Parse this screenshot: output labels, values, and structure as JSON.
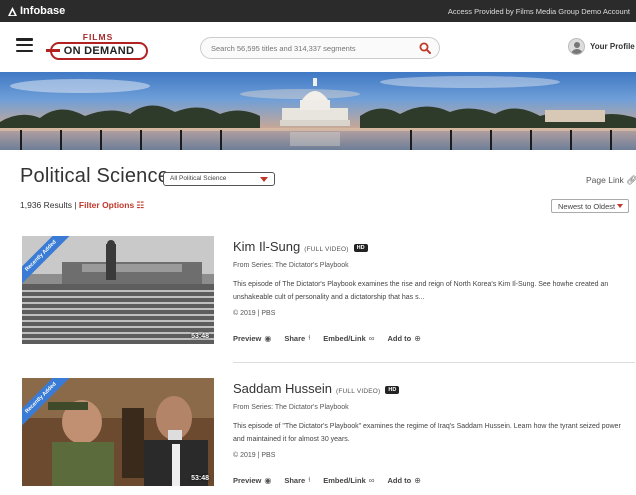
{
  "topbar": {
    "logo": "Infobase",
    "access_text": "Access Provided by Films Media Group Demo Account"
  },
  "header": {
    "brand_top": "FILMS",
    "brand_main": "ON DEMAND",
    "search_placeholder": "Search 56,595 titles and 314,337 segments",
    "profile_label": "Your Profile"
  },
  "section": {
    "title": "Political Science",
    "category_selected": "All Political Science",
    "page_link": "Page Link",
    "results_count": "1,936 Results",
    "results_separator": " | ",
    "filter_label": "Filter Options",
    "sort_selected": "Newest to Oldest"
  },
  "results": [
    {
      "title": "Kim Il-Sung",
      "type": "(FULL VIDEO)",
      "badge": "HD",
      "series": "From Series: The Dictator's Playbook",
      "description": "This episode of The Dictator's Playbook examines the rise and reign of North Korea's Kim Il-Sung. See howhe created an unshakeable cult of personality and a dictatorship that has s...",
      "meta": "© 2019 | PBS",
      "duration": "53:48",
      "ribbon": "Recently Added",
      "actions": [
        "Preview",
        "Share",
        "Embed/Link",
        "Add to"
      ]
    },
    {
      "title": "Saddam Hussein",
      "type": "(FULL VIDEO)",
      "badge": "HD",
      "series": "From Series: The Dictator's Playbook",
      "description": "This episode of \"The Dictator's Playbook\" examines the regime of Iraq's Saddam Hussein. Learn how the tyrant seized power and maintained it for almost 30 years.",
      "meta": "© 2019 | PBS",
      "duration": "53:48",
      "ribbon": "Recently Added",
      "actions": [
        "Preview",
        "Share",
        "Embed/Link",
        "Add to"
      ]
    }
  ],
  "colors": {
    "accent_red": "#c0392b",
    "topbar_bg": "#2b2b2b",
    "ribbon_blue": "#3a7bd5"
  },
  "icons": {
    "menu": "hamburger-icon",
    "search": "magnifier-icon",
    "profile": "user-avatar-icon",
    "page_link": "link-icon",
    "filter": "sliders-icon",
    "preview": "eye-icon",
    "share": "share-icon",
    "embed": "link-icon",
    "add": "plus-circle-icon"
  }
}
